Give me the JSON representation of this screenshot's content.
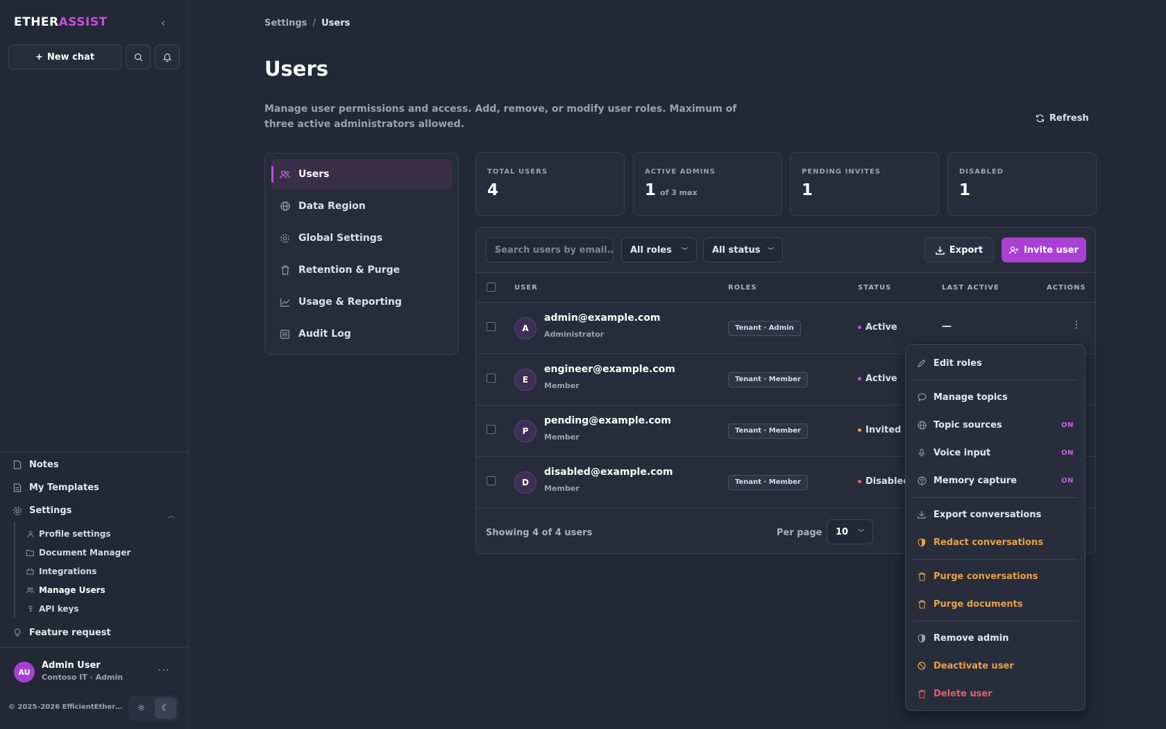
{
  "app": {
    "brand_part1": "ETHER",
    "brand_part2": "ASSIST",
    "new_chat": "New chat",
    "accent_color": "#c84cdb"
  },
  "sidebar": {
    "bottom_items": [
      {
        "label": "Notes",
        "icon": "note-icon"
      },
      {
        "label": "My Templates",
        "icon": "template-icon"
      },
      {
        "label": "Settings",
        "icon": "gear-icon"
      }
    ],
    "settings_sub": [
      {
        "label": "Profile settings",
        "icon": "person-icon"
      },
      {
        "label": "Document Manager",
        "icon": "folder-icon"
      },
      {
        "label": "Integrations",
        "icon": "plug-icon"
      },
      {
        "label": "Manage Users",
        "icon": "users-icon"
      },
      {
        "label": "API keys",
        "icon": "key-icon"
      }
    ],
    "feature_request": "Feature request",
    "user": {
      "initials": "AU",
      "name": "Admin User",
      "org": "Contoso IT · Admin"
    },
    "copyright": "© 2025–2026 EfficientEther L..."
  },
  "breadcrumb": {
    "parent": "Settings",
    "current": "Users"
  },
  "page": {
    "title": "Users",
    "description": "Manage user permissions and access. Add, remove, or modify user roles. Maximum of three active administrators allowed.",
    "refresh": "Refresh"
  },
  "settings_nav": [
    {
      "label": "Users",
      "icon": "users-icon"
    },
    {
      "label": "Data Region",
      "icon": "globe-icon"
    },
    {
      "label": "Global Settings",
      "icon": "gear-icon"
    },
    {
      "label": "Retention & Purge",
      "icon": "trash-icon"
    },
    {
      "label": "Usage & Reporting",
      "icon": "chart-icon"
    },
    {
      "label": "Audit Log",
      "icon": "list-icon"
    }
  ],
  "stats": [
    {
      "label": "TOTAL USERS",
      "value": "4",
      "suffix": ""
    },
    {
      "label": "ACTIVE ADMINS",
      "value": "1",
      "suffix": "of 3 max"
    },
    {
      "label": "PENDING INVITES",
      "value": "1",
      "suffix": ""
    },
    {
      "label": "DISABLED",
      "value": "1",
      "suffix": ""
    }
  ],
  "filters": {
    "search_placeholder": "Search users by email...",
    "roles": "All roles",
    "status": "All status",
    "export": "Export",
    "invite": "Invite user"
  },
  "table": {
    "headers": {
      "user": "USER",
      "roles": "ROLES",
      "status": "STATUS",
      "last_active": "LAST ACTIVE",
      "actions": "ACTIONS"
    },
    "rows": [
      {
        "initial": "A",
        "email": "admin@example.com",
        "role": "Administrator",
        "badge": "Tenant · Admin",
        "status": "Active",
        "status_color": "#c84cdb",
        "last": "—"
      },
      {
        "initial": "E",
        "email": "engineer@example.com",
        "role": "Member",
        "badge": "Tenant · Member",
        "status": "Active",
        "status_color": "#c84cdb",
        "last": ""
      },
      {
        "initial": "P",
        "email": "pending@example.com",
        "role": "Member",
        "badge": "Tenant · Member",
        "status": "Invited",
        "status_color": "#e9a14a",
        "last": ""
      },
      {
        "initial": "D",
        "email": "disabled@example.com",
        "role": "Member",
        "badge": "Tenant · Member",
        "status": "Disabled",
        "status_color": "#ea5e6b",
        "last": ""
      }
    ],
    "footer": "Showing 4 of 4 users",
    "per_page_label": "Per page",
    "per_page_value": "10"
  },
  "action_menu": {
    "items": [
      {
        "label": "Edit roles",
        "icon": "pencil-icon",
        "tone": "normal",
        "badge": ""
      },
      {
        "label": "Manage topics",
        "icon": "chat-bubble-icon",
        "tone": "normal",
        "badge": ""
      },
      {
        "label": "Topic sources",
        "icon": "globe-icon",
        "tone": "normal",
        "badge": "ON"
      },
      {
        "label": "Voice input",
        "icon": "microphone-icon",
        "tone": "normal",
        "badge": "ON"
      },
      {
        "label": "Memory capture",
        "icon": "brain-icon",
        "tone": "normal",
        "badge": "ON"
      },
      {
        "label": "Export conversations",
        "icon": "download-icon",
        "tone": "normal",
        "badge": ""
      },
      {
        "label": "Redact conversations",
        "icon": "shield-half-icon",
        "tone": "warn",
        "badge": ""
      },
      {
        "label": "Purge conversations",
        "icon": "trash-icon",
        "tone": "warn",
        "badge": ""
      },
      {
        "label": "Purge documents",
        "icon": "trash-icon",
        "tone": "warn",
        "badge": ""
      },
      {
        "label": "Remove admin",
        "icon": "shield-half-icon",
        "tone": "normal",
        "badge": ""
      },
      {
        "label": "Deactivate user",
        "icon": "ban-icon",
        "tone": "warn",
        "badge": ""
      },
      {
        "label": "Delete user",
        "icon": "trash-icon",
        "tone": "danger",
        "badge": ""
      }
    ]
  }
}
